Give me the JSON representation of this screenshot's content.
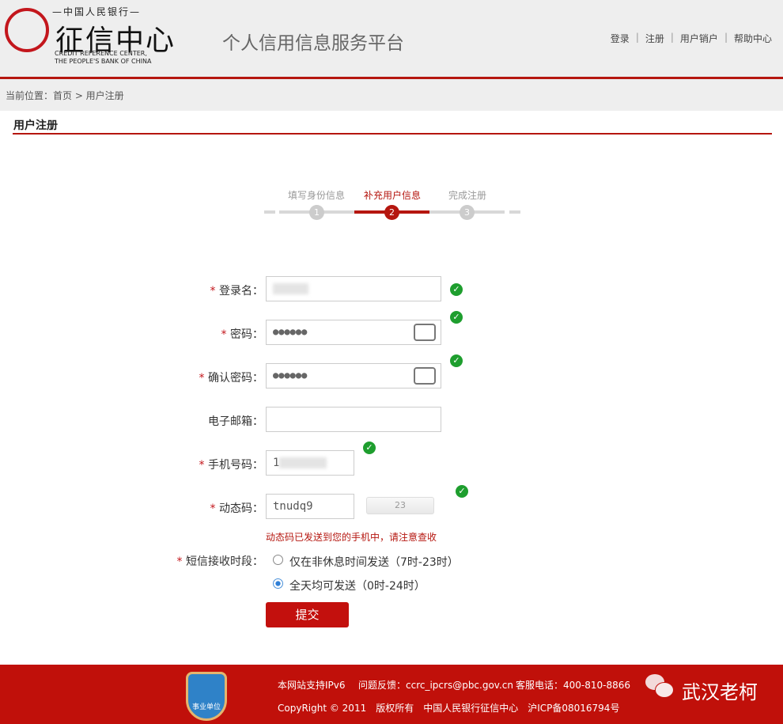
{
  "header": {
    "logo_small": "—中国人民银行—",
    "logo_title": "征信中心",
    "logo_en1": "CREDIT REFERENCE CENTER,",
    "logo_en2": "THE PEOPLE'S BANK OF CHINA",
    "platform": "个人信用信息服务平台",
    "nav": [
      "登录",
      "注册",
      "用户销户",
      "帮助中心"
    ]
  },
  "breadcrumb": "当前位置：首页 > 用户注册",
  "page_title": "用户注册",
  "steps": [
    {
      "label": "填写身份信息",
      "num": "1"
    },
    {
      "label": "补充用户信息",
      "num": "2"
    },
    {
      "label": "完成注册",
      "num": "3"
    }
  ],
  "form": {
    "login_label": "登录名：",
    "login_value": "",
    "password_label": "密码：",
    "password_value": "●●●●●●",
    "confirm_label": "确认密码：",
    "confirm_value": "●●●●●●",
    "email_label": "电子邮箱：",
    "email_value": "",
    "phone_label": "手机号码：",
    "phone_value": "1",
    "code_label": "动态码：",
    "code_value": "tnudq9",
    "countdown": "23",
    "code_hint": "动态码已发送到您的手机中，请注意查收",
    "sms_label": "短信接收时段：",
    "sms_options": [
      "仅在非休息时间发送（7时-23时）",
      "全天均可发送（0时-24时）"
    ],
    "sms_selected": 1,
    "required_mark": "*",
    "submit": "提交"
  },
  "footer": {
    "ipv6": "本网站支持IPv6",
    "feedback": "问题反馈：ccrc_ipcrs@pbc.gov.cn",
    "phone": "客服电话：400-810-8866",
    "copyright": "CopyRight © 2011　版权所有　中国人民银行征信中心　沪ICP备08016794号",
    "badge": "事业单位",
    "watermark": "武汉老柯"
  },
  "colors": {
    "brand_red": "#b5160f",
    "success": "#1e9e2e"
  }
}
